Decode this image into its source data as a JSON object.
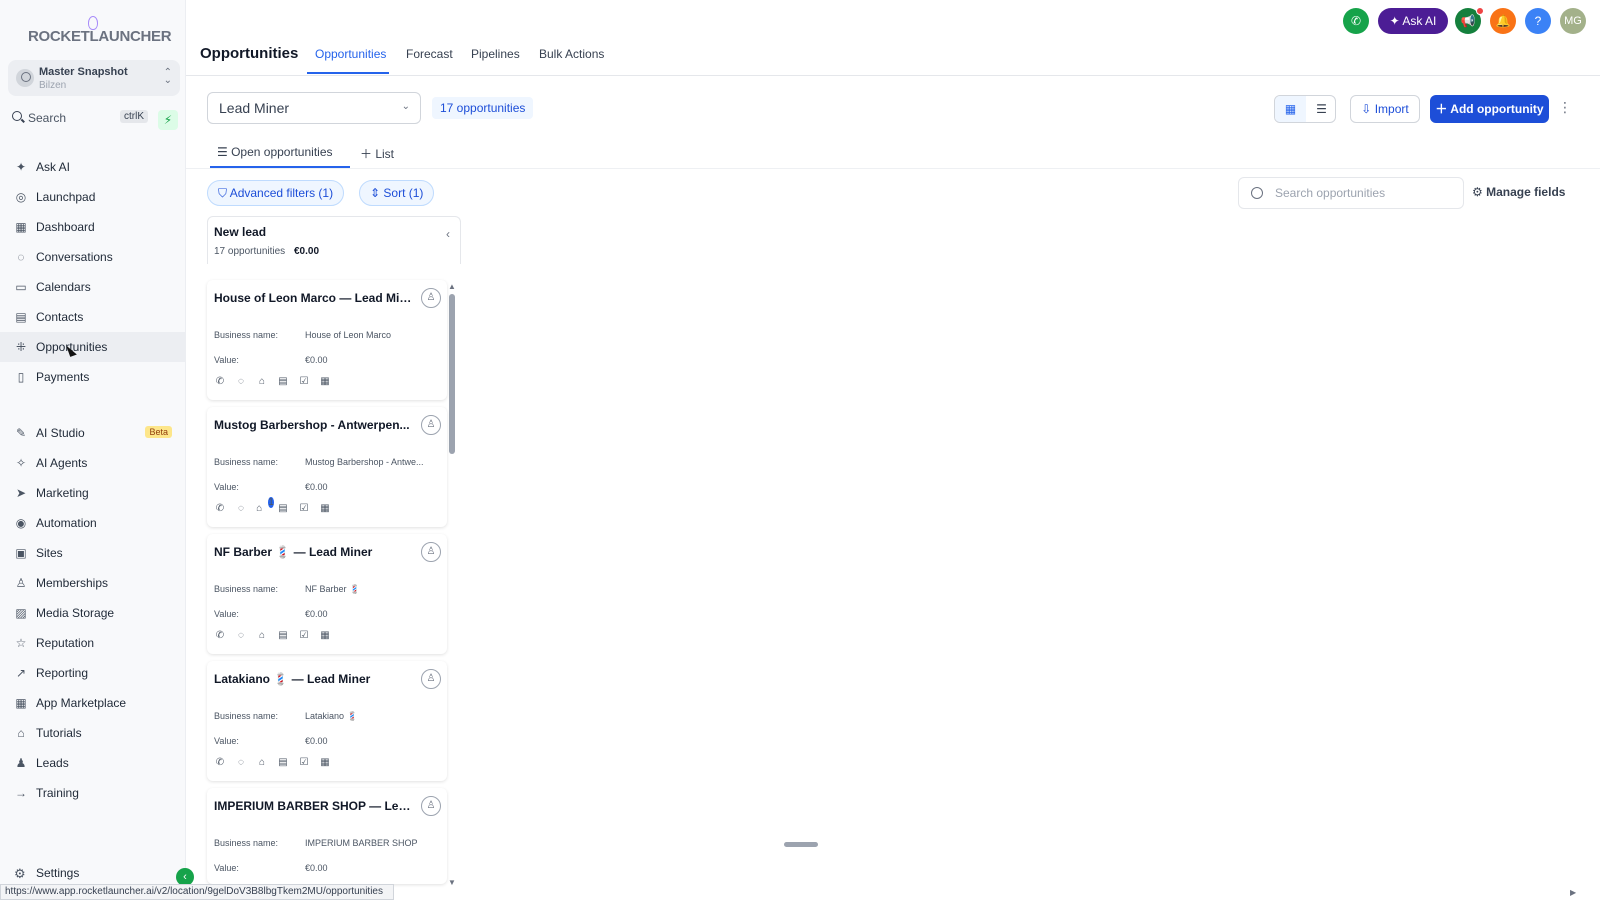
{
  "app": {
    "brand": "ROCKETLAUNCHER"
  },
  "workspace": {
    "name": "Master Snapshot",
    "location": "Bilzen"
  },
  "search": {
    "label": "Search",
    "shortcut": "ctrlK"
  },
  "sidebar": {
    "items": [
      {
        "label": "Ask AI",
        "icon": "sparkles-icon"
      },
      {
        "label": "Launchpad",
        "icon": "rocket-icon"
      },
      {
        "label": "Dashboard",
        "icon": "grid-icon"
      },
      {
        "label": "Conversations",
        "icon": "chat-icon"
      },
      {
        "label": "Calendars",
        "icon": "calendar-icon"
      },
      {
        "label": "Contacts",
        "icon": "contacts-icon"
      },
      {
        "label": "Opportunities",
        "icon": "opportunities-icon",
        "active": true
      },
      {
        "label": "Payments",
        "icon": "payments-icon"
      }
    ],
    "items2": [
      {
        "label": "AI Studio",
        "icon": "ai-studio-icon",
        "badge": "Beta"
      },
      {
        "label": "AI Agents",
        "icon": "ai-agents-icon"
      },
      {
        "label": "Marketing",
        "icon": "send-icon"
      },
      {
        "label": "Automation",
        "icon": "automation-icon"
      },
      {
        "label": "Sites",
        "icon": "sites-icon"
      },
      {
        "label": "Memberships",
        "icon": "memberships-icon"
      },
      {
        "label": "Media Storage",
        "icon": "image-icon"
      },
      {
        "label": "Reputation",
        "icon": "star-icon"
      },
      {
        "label": "Reporting",
        "icon": "trend-icon"
      },
      {
        "label": "App Marketplace",
        "icon": "apps-icon"
      },
      {
        "label": "Tutorials",
        "icon": "graduation-icon"
      },
      {
        "label": "Leads",
        "icon": "users-icon"
      },
      {
        "label": "Training",
        "icon": "arrow-right-icon"
      }
    ],
    "settings": "Settings"
  },
  "header": {
    "title": "Opportunities",
    "tabs": [
      "Opportunities",
      "Forecast",
      "Pipelines",
      "Bulk Actions"
    ],
    "ask_ai": "Ask AI",
    "avatar": "MG"
  },
  "toolbar": {
    "pipeline": "Lead Miner",
    "count": "17 opportunities",
    "import": "Import",
    "add": "Add opportunity"
  },
  "subtabs": {
    "open": "Open opportunities",
    "list": "List"
  },
  "filters": {
    "advanced": "Advanced filters (1)",
    "sort": "Sort (1)",
    "search_placeholder": "Search opportunities",
    "manage_fields": "Manage fields"
  },
  "column": {
    "title": "New lead",
    "count": "17 opportunities",
    "value": "€0.00"
  },
  "labels": {
    "business": "Business name:",
    "value": "Value:"
  },
  "cards": [
    {
      "title": "House of Leon Marco — Lead Miner",
      "business": "House of Leon Marco",
      "value": "€0.00"
    },
    {
      "title": "Mustog Barbershop - Antwerpen...",
      "business": "Mustog Barbershop - Antwe...",
      "value": "€0.00",
      "tag_count": "1"
    },
    {
      "title": "NF Barber 💈 — Lead Miner",
      "business": "NF Barber 💈",
      "value": "€0.00"
    },
    {
      "title": "Latakiano 💈 — Lead Miner",
      "business": "Latakiano 💈",
      "value": "€0.00"
    },
    {
      "title": "IMPERIUM BARBER SHOP — Lead...",
      "business": "IMPERIUM BARBER SHOP",
      "value": "€0.00"
    }
  ],
  "status_url": "https://www.app.rocketlauncher.ai/v2/location/9gelDoV3B8lbgTkem2MU/opportunities",
  "colors": {
    "primary": "#1d4ed8",
    "green": "#16a34a",
    "purple": "#4c1d95",
    "orange": "#f97316",
    "help": "#3b82f6"
  }
}
